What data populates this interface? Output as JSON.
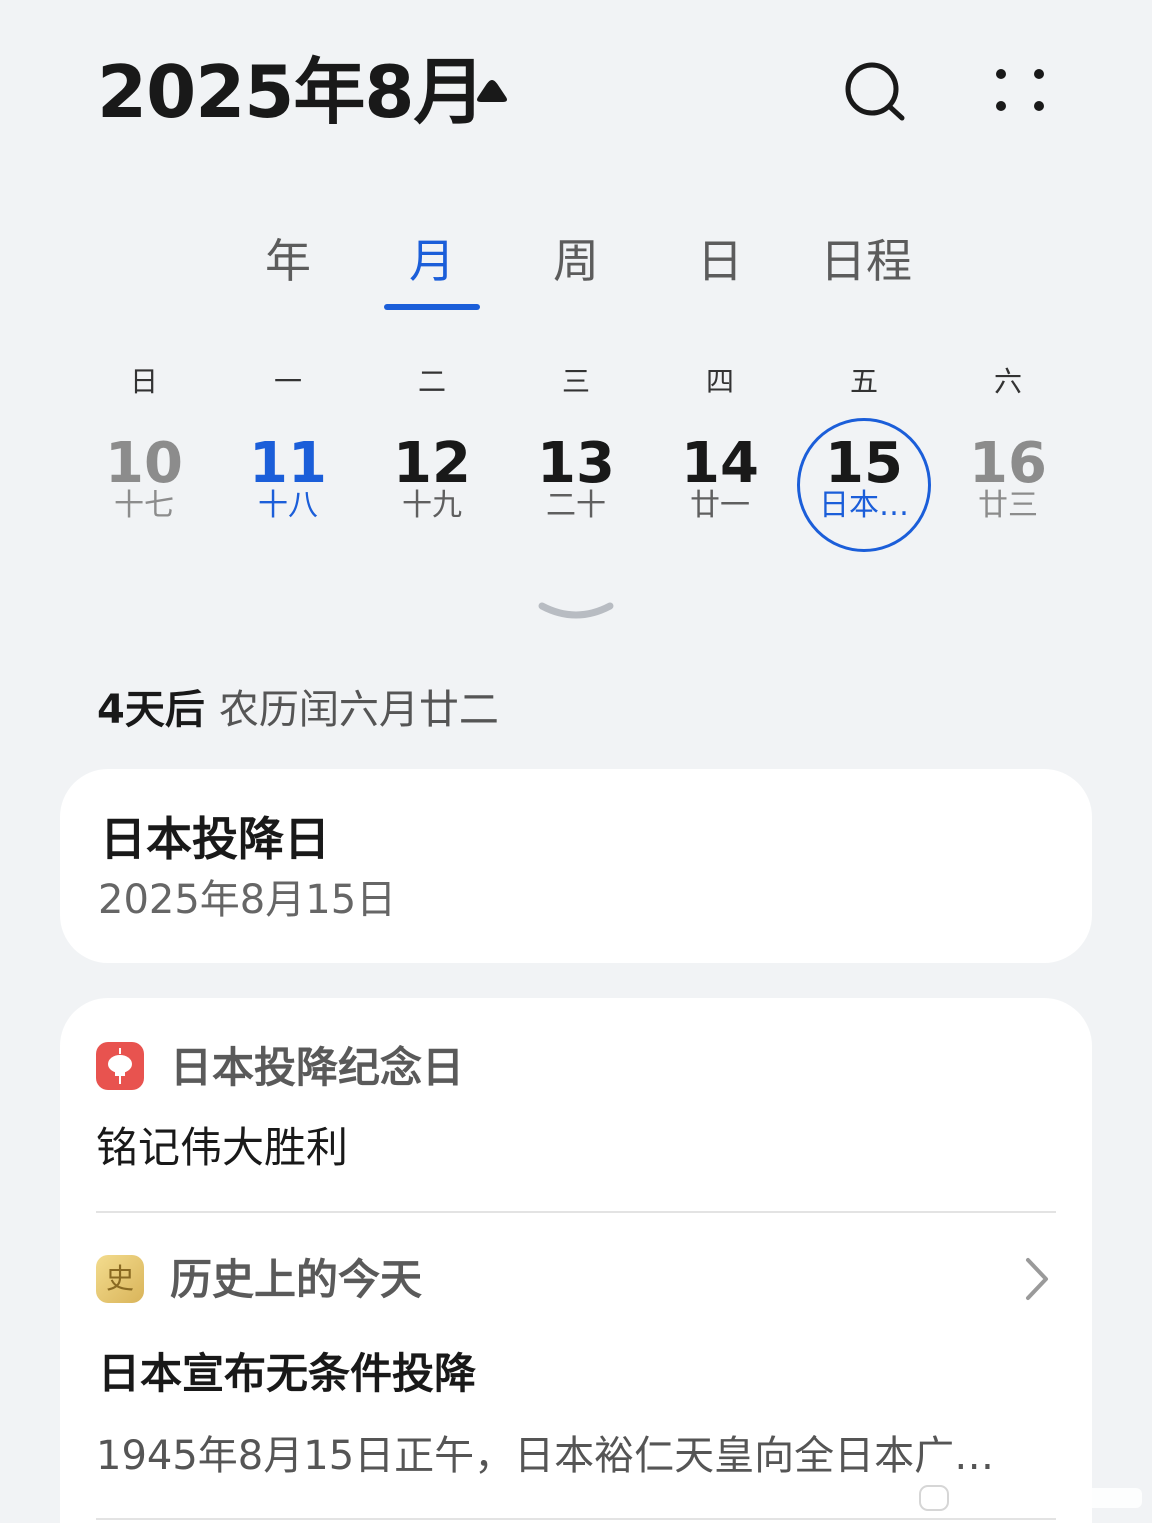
{
  "header": {
    "title": "2025年8月",
    "caret_icon": "caret-up-icon",
    "search_icon": "search-icon",
    "more_icon": "more-dots-icon"
  },
  "tabs": [
    {
      "label": "年"
    },
    {
      "label": "月",
      "active": true
    },
    {
      "label": "周"
    },
    {
      "label": "日"
    },
    {
      "label": "日程"
    }
  ],
  "week": {
    "weekdays": [
      "日",
      "一",
      "二",
      "三",
      "四",
      "五",
      "六"
    ],
    "days": [
      {
        "num": "10",
        "lunar": "十七"
      },
      {
        "num": "11",
        "lunar": "十八",
        "today": true
      },
      {
        "num": "12",
        "lunar": "十九"
      },
      {
        "num": "13",
        "lunar": "二十"
      },
      {
        "num": "14",
        "lunar": "廿一"
      },
      {
        "num": "15",
        "lunar": "日本…",
        "selected": true
      },
      {
        "num": "16",
        "lunar": "廿三"
      }
    ]
  },
  "summary": {
    "relative": "4天后",
    "lunar_date": "农历闰六月廿二"
  },
  "event_card": {
    "title": "日本投降日",
    "date": "2025年8月15日"
  },
  "info_card": {
    "section1": {
      "title": "日本投降纪念日",
      "subtitle": "铭记伟大胜利"
    },
    "section2": {
      "title": "历史上的今天",
      "icon_glyph": "史",
      "headline": "日本宣布无条件投降",
      "description": "1945年8月15日正午，日本裕仁天皇向全日本广…"
    }
  },
  "colors": {
    "accent": "#1b5ed9",
    "background": "#f1f3f5",
    "card": "#ffffff",
    "festival_icon": "#e8534f"
  }
}
